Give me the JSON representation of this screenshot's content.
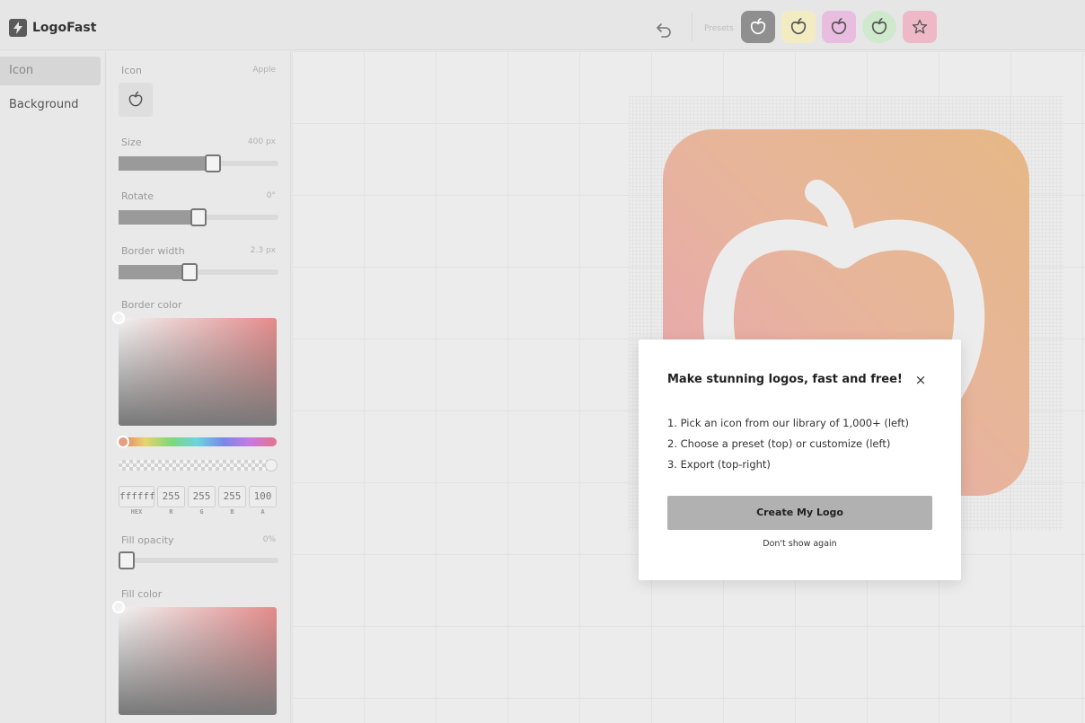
{
  "app": {
    "name": "LogoFast"
  },
  "toolbar": {
    "presets_label": "Presets",
    "presets": [
      {
        "icon": "apple-icon",
        "bg": "#8f8f8f"
      },
      {
        "icon": "apple-icon",
        "bg": "#f3ecc3"
      },
      {
        "icon": "apple-icon",
        "bg": "#e9bde0"
      },
      {
        "icon": "apple-icon",
        "bg": "#cfe9cd"
      },
      {
        "icon": "star-icon",
        "bg": "#eeb8c6"
      }
    ]
  },
  "nav": {
    "items": [
      {
        "label": "Icon"
      },
      {
        "label": "Background"
      }
    ]
  },
  "panel": {
    "icon_label": "Icon",
    "icon_value": "Apple",
    "size_label": "Size",
    "size_value": "400 px",
    "size_fraction": 0.62,
    "rotate_label": "Rotate",
    "rotate_value": "0°",
    "rotate_fraction": 0.5,
    "border_width_label": "Border width",
    "border_width_value": "2.3 px",
    "border_width_fraction": 0.45,
    "border_color_label": "Border color",
    "hex": "ffffff",
    "r": "255",
    "g": "255",
    "b": "255",
    "a": "100",
    "hex_label": "HEX",
    "r_label": "R",
    "g_label": "G",
    "b_label": "B",
    "a_label": "A",
    "fill_opacity_label": "Fill opacity",
    "fill_opacity_value": "0%",
    "fill_color_label": "Fill color"
  },
  "logo": {
    "gradient_start": "#e8a4b4",
    "gradient_end": "#e6b886",
    "icon_color": "#ececec"
  },
  "modal": {
    "title": "Make stunning logos, fast and free!",
    "close": "×",
    "steps": [
      "1. Pick an icon from our library of 1,000+ (left)",
      "2. Choose a preset (top) or customize (left)",
      "3. Export (top-right)"
    ],
    "cta": "Create My Logo",
    "dont_show": "Don't show again"
  }
}
